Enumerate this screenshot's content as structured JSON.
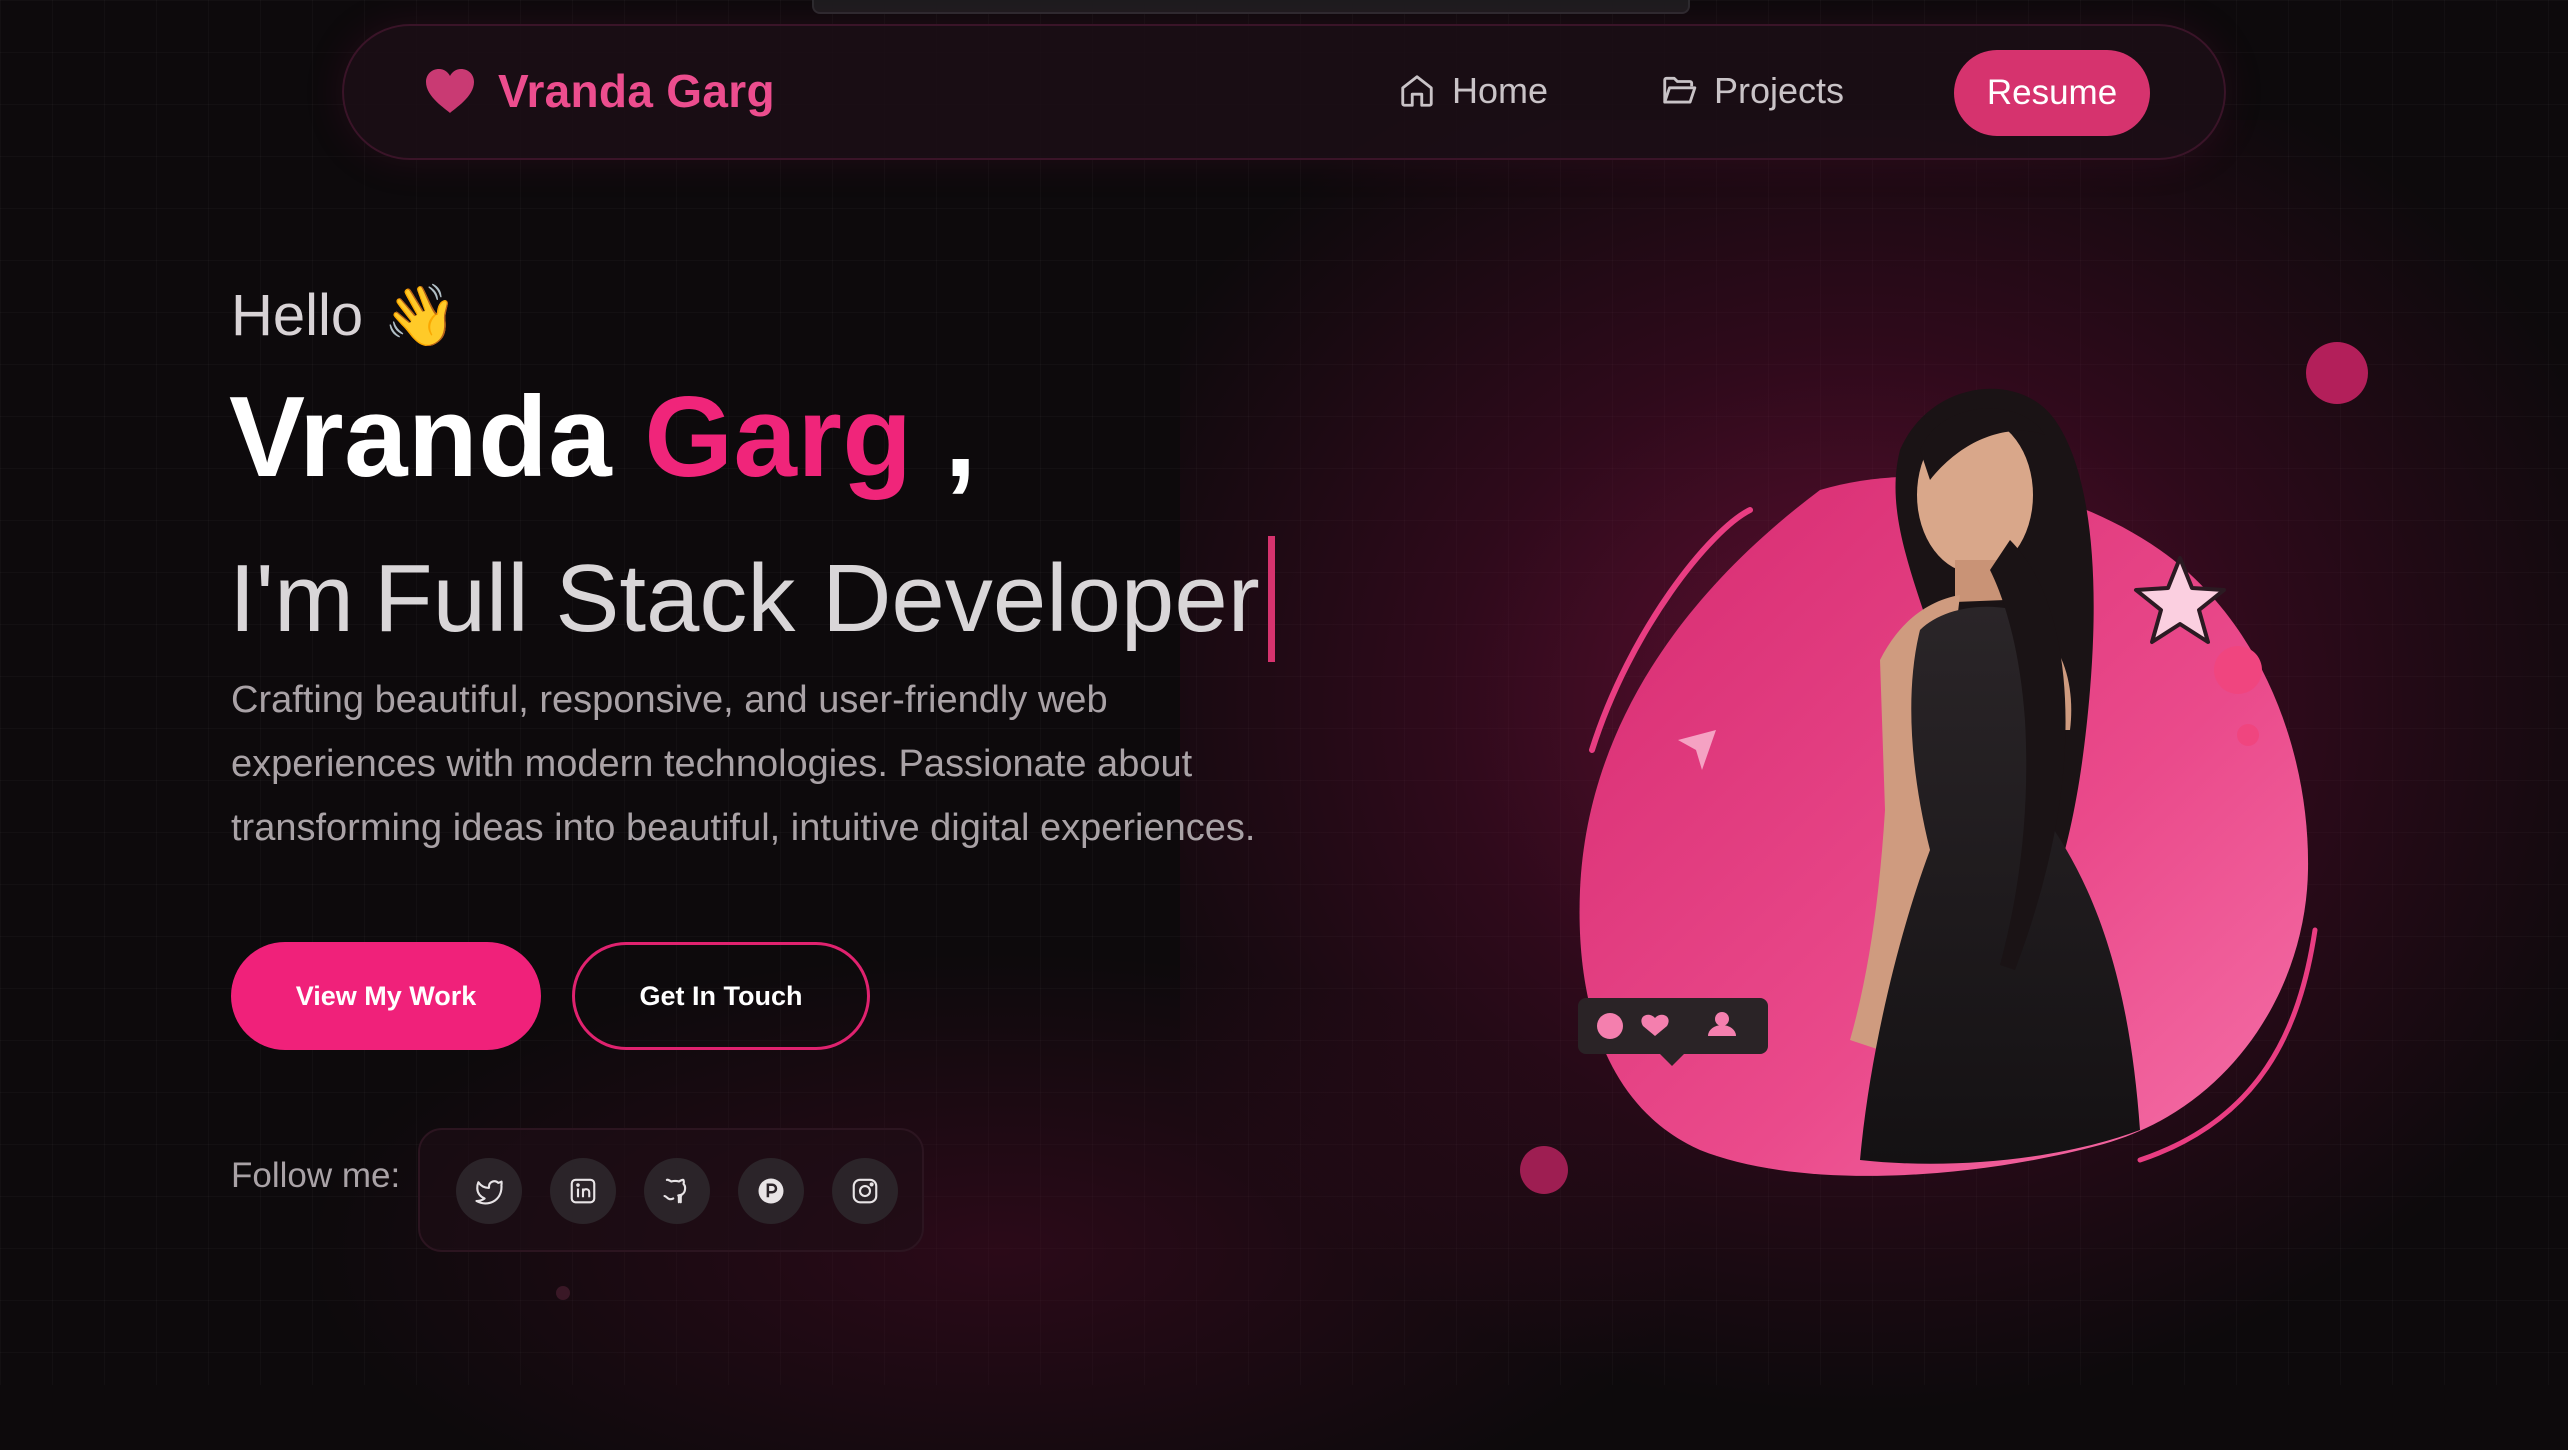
{
  "nav": {
    "brand": "Vranda Garg",
    "items": [
      {
        "label": "Home",
        "icon": "home-icon"
      },
      {
        "label": "Projects",
        "icon": "folder-icon"
      }
    ],
    "resume": "Resume"
  },
  "hero": {
    "greeting": "Hello",
    "wave": "👋",
    "first_name": "Vranda",
    "last_name": "Garg",
    "comma": ",",
    "role_prefix": "I'm",
    "role": "Full Stack Developer",
    "description": "Crafting beautiful, responsive, and user-friendly web experiences with modern technologies. Passionate about transforming ideas into beautiful, intuitive digital experiences.",
    "primary_cta": "View My Work",
    "secondary_cta": "Get In Touch"
  },
  "social": {
    "label": "Follow me:",
    "links": [
      {
        "icon": "twitter-icon"
      },
      {
        "icon": "linkedin-icon"
      },
      {
        "icon": "github-icon"
      },
      {
        "icon": "producthunt-icon"
      },
      {
        "icon": "instagram-icon"
      }
    ]
  },
  "colors": {
    "background": "#0d0a0c",
    "accent": "#f0217a",
    "brand": "#ec4d8e",
    "resume": "#d6336e",
    "blob": "#e93d82"
  }
}
